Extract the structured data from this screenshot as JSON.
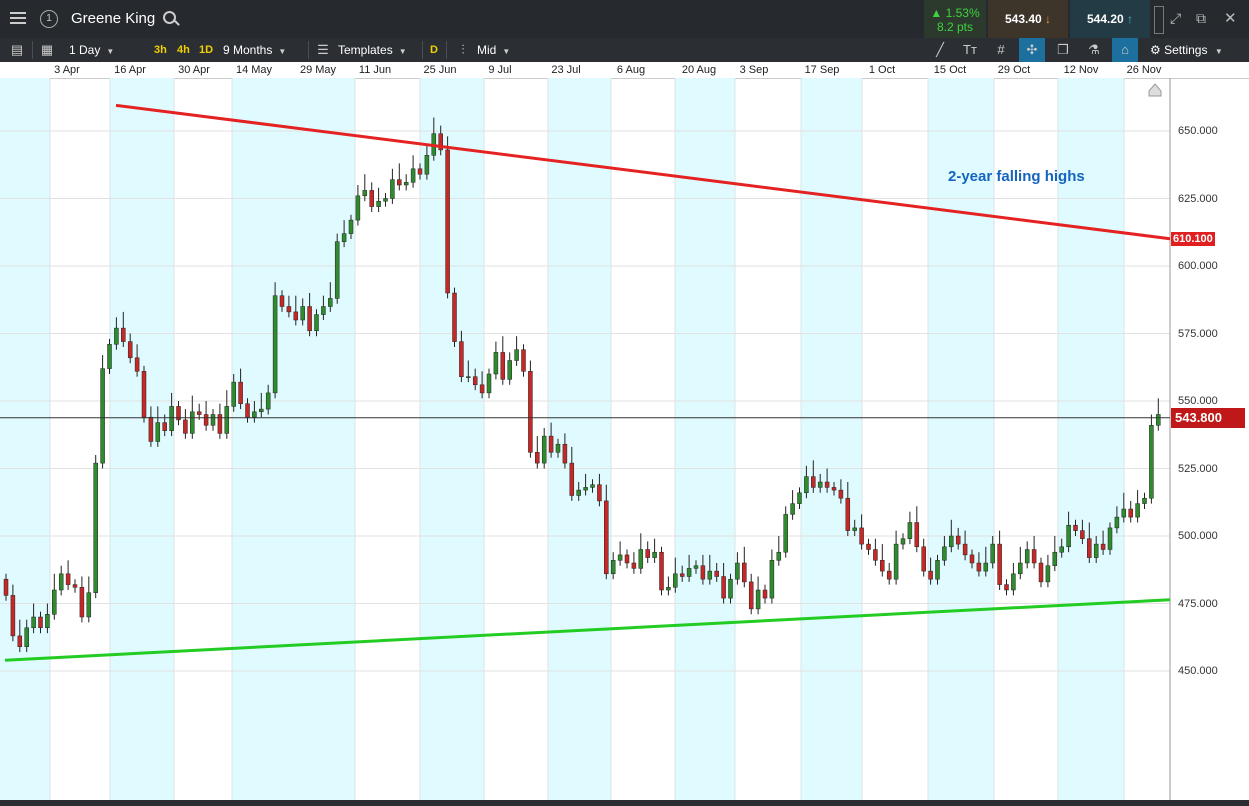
{
  "header": {
    "instrument_number": "1",
    "instrument": "Greene King",
    "change_pct": "▲ 1.53%",
    "change_pts": "8.2 pts",
    "sell_price": "543.40",
    "buy_price": "544.20"
  },
  "toolbar": {
    "interval": "1 Day",
    "quick_intervals": [
      "3h",
      "4h",
      "1D"
    ],
    "range": "9 Months",
    "templates": "Templates",
    "d_label": "D",
    "price_mode": "Mid",
    "settings": "Settings"
  },
  "colors": {
    "up": "#2e8b2e",
    "down": "#c62828",
    "resistance": "#e52222",
    "support": "#22cc22",
    "band": "#dffbff"
  },
  "chart_data": {
    "type": "candlestick",
    "annotation": "2-year falling highs",
    "x_labels": [
      "3 Apr",
      "16 Apr",
      "30 Apr",
      "14 May",
      "29 May",
      "11 Jun",
      "25 Jun",
      "9 Jul",
      "23 Jul",
      "6 Aug",
      "20 Aug",
      "3 Sep",
      "17 Sep",
      "1 Oct",
      "15 Oct",
      "29 Oct",
      "12 Nov",
      "26 Nov"
    ],
    "y_ticks": [
      "650.000",
      "625.000",
      "600.000",
      "575.000",
      "550.000",
      "525.000",
      "500.000",
      "475.000",
      "450.000"
    ],
    "ylim": [
      440,
      660
    ],
    "trendlines": [
      {
        "name": "resistance",
        "from_x": "13 Apr",
        "from_y": 659.5,
        "to_x": "30 Nov",
        "to_y": 610.1,
        "label": "610.100"
      },
      {
        "name": "support",
        "from_x": "1 Apr",
        "from_y": 454,
        "to_x": "30 Nov",
        "to_y": 476.4
      }
    ],
    "current_price": "543.800",
    "current_value": 543.8,
    "closes": [
      478,
      463,
      459,
      466,
      470,
      466,
      471,
      480,
      486,
      482,
      481,
      470,
      479,
      527,
      562,
      571,
      577,
      572,
      566,
      561,
      544,
      535,
      542,
      539,
      548,
      543,
      538,
      546,
      545,
      541,
      545,
      538,
      548,
      557,
      549,
      544,
      546,
      547,
      553,
      589,
      585,
      583,
      580,
      585,
      576,
      582,
      585,
      588,
      609,
      612,
      617,
      626,
      628,
      622,
      624,
      625,
      632,
      630,
      631,
      636,
      634,
      641,
      649,
      643,
      590,
      572,
      559,
      559,
      556,
      553,
      560,
      568,
      558,
      565,
      569,
      561,
      531,
      527,
      537,
      531,
      534,
      527,
      515,
      517,
      518,
      519,
      513,
      486,
      491,
      493,
      490,
      488,
      495,
      492,
      494,
      480,
      481,
      486,
      485,
      488,
      489,
      484,
      487,
      485,
      477,
      484,
      490,
      483,
      473,
      480,
      477,
      491,
      494,
      508,
      512,
      516,
      522,
      518,
      520,
      518,
      517,
      514,
      502,
      503,
      497,
      495,
      491,
      487,
      484,
      497,
      499,
      505,
      496,
      487,
      484,
      491,
      496,
      500,
      497,
      493,
      490,
      487,
      490,
      497,
      482,
      480,
      486,
      490,
      495,
      490,
      483,
      489,
      494,
      496,
      504,
      502,
      499,
      492,
      497,
      495,
      503,
      507,
      510,
      507,
      512,
      514,
      541,
      545
    ],
    "closes_note_do_not_render": ""
  }
}
